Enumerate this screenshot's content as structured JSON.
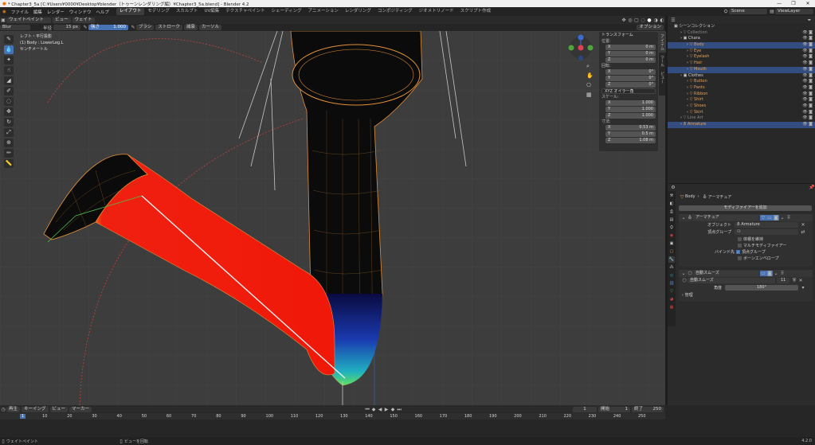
{
  "window": {
    "title": "* Chapter3_5a [C:¥Users¥0000¥Desktop¥blender（トゥーンレンダリング編）¥Chapter3_5a.blend] - Blender 4.2",
    "controls": [
      "—",
      "❐",
      "✕"
    ]
  },
  "menu": {
    "items": [
      "ファイル",
      "編集",
      "レンダー",
      "ウィンドウ",
      "ヘルプ"
    ],
    "workspaces": [
      "レイアウト",
      "モデリング",
      "スカルプト",
      "UV編集",
      "テクスチャペイント",
      "シェーディング",
      "アニメーション",
      "レンダリング",
      "コンポジティング",
      "ジオメトリノード",
      "スクリプト作成"
    ],
    "active_workspace": "レイアウト",
    "scene_label": "Scene",
    "viewlayer_label": "ViewLayer"
  },
  "viewport_header": {
    "mode": "ウェイトペイント",
    "menus": [
      "ビュー",
      "ウェイト"
    ],
    "options_label": "オプション"
  },
  "tool_settings": {
    "brush": "Blur",
    "radius_label": "半径",
    "radius_value": "15 px",
    "strength_label": "強さ",
    "strength_value": "1.000",
    "menus": [
      "ブラシ",
      "ストローク",
      "減衰",
      "カーソル"
    ]
  },
  "viewport_info": {
    "line1": "レフト・平行投影",
    "line2": "(1) Body : LowerLeg.L",
    "line3": "センチメートル"
  },
  "transform_panel": {
    "header": "トランスフォーム",
    "location_label": "位置:",
    "location": [
      [
        "X",
        "0 m"
      ],
      [
        "Y",
        "0 m"
      ],
      [
        "Z",
        "0 m"
      ]
    ],
    "rotation_label": "回転:",
    "rotation": [
      [
        "X",
        "0°"
      ],
      [
        "Y",
        "0°"
      ],
      [
        "Z",
        "0°"
      ]
    ],
    "rotation_mode": "XYZ オイラー角",
    "scale_label": "スケール:",
    "scale": [
      [
        "X",
        "1.000"
      ],
      [
        "Y",
        "1.000"
      ],
      [
        "Z",
        "1.000"
      ]
    ],
    "dimensions_label": "寸法:",
    "dimensions": [
      [
        "X",
        "0.53 m"
      ],
      [
        "Y",
        "0.5 m"
      ],
      [
        "Z",
        "1.08 m"
      ]
    ]
  },
  "n_tabs": [
    "アイテム",
    "ツール",
    "ビュー"
  ],
  "outliner": {
    "title": "シーンコレクション",
    "items": [
      {
        "label": "Collection",
        "indent": 1,
        "style": "grey",
        "selected": false
      },
      {
        "label": "Chara",
        "indent": 1,
        "style": "normal",
        "selected": false
      },
      {
        "label": "Body",
        "indent": 2,
        "style": "orange",
        "selected": true
      },
      {
        "label": "Eye",
        "indent": 2,
        "style": "orange",
        "selected": false
      },
      {
        "label": "Eyelash",
        "indent": 2,
        "style": "orange",
        "selected": false
      },
      {
        "label": "Hair",
        "indent": 2,
        "style": "orange",
        "selected": false
      },
      {
        "label": "Mouth",
        "indent": 2,
        "style": "orange",
        "selected": true
      },
      {
        "label": "Clothes",
        "indent": 1,
        "style": "normal",
        "selected": false
      },
      {
        "label": "Button",
        "indent": 2,
        "style": "orange",
        "selected": false
      },
      {
        "label": "Pants",
        "indent": 2,
        "style": "orange",
        "selected": false
      },
      {
        "label": "Ribbon",
        "indent": 2,
        "style": "orange",
        "selected": false
      },
      {
        "label": "Shirt",
        "indent": 2,
        "style": "orange",
        "selected": false
      },
      {
        "label": "Shoes",
        "indent": 2,
        "style": "orange",
        "selected": false
      },
      {
        "label": "Skirt",
        "indent": 2,
        "style": "orange",
        "selected": false
      },
      {
        "label": "Line Art",
        "indent": 1,
        "style": "grey",
        "selected": false
      },
      {
        "label": "Armature",
        "indent": 1,
        "style": "orange",
        "selected": true
      }
    ]
  },
  "properties": {
    "breadcrumb_object": "Body",
    "breadcrumb_modifier": "アーマチュア",
    "add_modifier": "モディファイアーを追加",
    "armature_modifier": {
      "name": "アーマチュア",
      "object_label": "オブジェクト",
      "object_value": "Armature",
      "vgroup_label": "頂点グループ",
      "preserve_volume": "体積を維持",
      "multi_modifier": "マルチモディファイアー",
      "bind_label": "バインド先",
      "bind_vgroups": "頂点グループ",
      "bind_envelope": "ボーンエンベロープ"
    },
    "smooth_modifier": {
      "name": "自動スムーズ",
      "node_name": "自動スムーズ",
      "node_users": "11",
      "angle_label": "角度",
      "angle_value": "180°",
      "manage_label": "管理"
    }
  },
  "timeline": {
    "menus": [
      "再生",
      "キーイング",
      "ビュー",
      "マーカー"
    ],
    "current_frame": "1",
    "start_label": "開始",
    "start_value": "1",
    "end_label": "終了",
    "end_value": "250",
    "ticks": [
      "1",
      "10",
      "20",
      "30",
      "40",
      "50",
      "60",
      "70",
      "80",
      "90",
      "100",
      "110",
      "120",
      "130",
      "140",
      "150",
      "160",
      "170",
      "180",
      "190",
      "200",
      "210",
      "220",
      "230",
      "240",
      "250"
    ]
  },
  "statusbar": {
    "left": "ウェイトペイント",
    "middle": "ビューを回転",
    "right": "",
    "version": "4.2.0"
  }
}
